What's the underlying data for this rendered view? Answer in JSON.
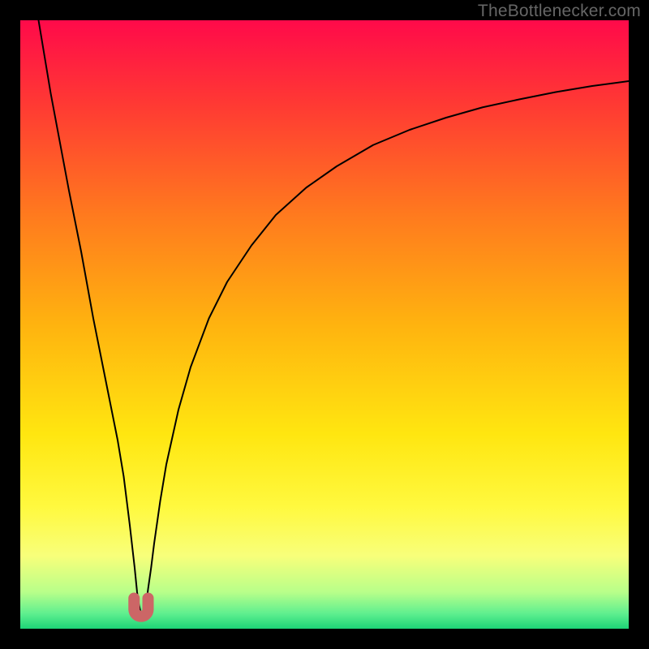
{
  "watermark": "TheBottlenecker.com",
  "chart_data": {
    "type": "line",
    "title": "",
    "xlabel": "",
    "ylabel": "",
    "xlim": [
      0,
      100
    ],
    "ylim": [
      0,
      100
    ],
    "series": [
      {
        "name": "bottleneck-curve",
        "x": [
          3,
          5,
          8,
          10,
          12,
          14,
          16,
          17,
          17.5,
          18,
          18.8,
          19.2,
          19.5,
          19.8,
          20,
          20.3,
          20.7,
          21,
          21.5,
          22,
          23,
          24,
          26,
          28,
          31,
          34,
          38,
          42,
          47,
          52,
          58,
          64,
          70,
          76,
          82,
          88,
          94,
          100
        ],
        "values": [
          100,
          88,
          72,
          62,
          51,
          41,
          31,
          25,
          21,
          17,
          10,
          6,
          4,
          2.6,
          2.2,
          2.6,
          4,
          6.5,
          10,
          14,
          21,
          27,
          36,
          43,
          51,
          57,
          63,
          68,
          72.5,
          76,
          79.5,
          82,
          84,
          85.7,
          87,
          88.2,
          89.2,
          90
        ],
        "color": "#000000"
      }
    ],
    "marker": {
      "shape": "U",
      "x_range": [
        18.7,
        21
      ],
      "y_range": [
        2,
        5
      ],
      "color": "#cc6666"
    },
    "background_gradient": {
      "stops": [
        {
          "offset": 0.0,
          "color": "#ff0a4a"
        },
        {
          "offset": 0.14,
          "color": "#ff3a33"
        },
        {
          "offset": 0.32,
          "color": "#ff7a1e"
        },
        {
          "offset": 0.5,
          "color": "#ffb30f"
        },
        {
          "offset": 0.68,
          "color": "#ffe610"
        },
        {
          "offset": 0.8,
          "color": "#fff93f"
        },
        {
          "offset": 0.88,
          "color": "#f8ff7a"
        },
        {
          "offset": 0.94,
          "color": "#b8ff8a"
        },
        {
          "offset": 0.975,
          "color": "#5fef8f"
        },
        {
          "offset": 1.0,
          "color": "#1dd477"
        }
      ]
    },
    "grid": false,
    "legend": false
  }
}
